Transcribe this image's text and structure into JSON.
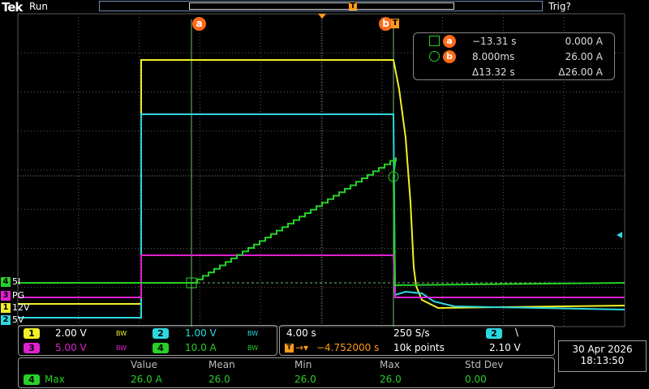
{
  "header": {
    "brand": "Tek",
    "status": "Run",
    "trigger_state": "Trig?"
  },
  "colors": {
    "ch1": "#f0f028",
    "ch2": "#2cd8e0",
    "ch3": "#e020d0",
    "ch4": "#28d028",
    "cursor": "#ff6a1a",
    "grid": "#5a5a5a"
  },
  "cursors": {
    "a_label": "a",
    "b_label": "b",
    "readout": {
      "a_time": "−13.31 s",
      "a_value": "0.000 A",
      "b_time": "8.000ms",
      "b_value": "26.00 A",
      "delta_time": "Δ13.32 s",
      "delta_value": "Δ26.00 A"
    }
  },
  "channel_labels": [
    {
      "num": "4",
      "text": "5I",
      "color": "#28d028"
    },
    {
      "num": "3",
      "text": "PG",
      "color": "#e020d0"
    },
    {
      "num": "1",
      "text": "12V",
      "color": "#f0f028"
    },
    {
      "num": "2",
      "text": "5V",
      "color": "#2cd8e0"
    }
  ],
  "channels": {
    "ch1": {
      "num": "1",
      "scale": "2.00 V",
      "bw": "BW"
    },
    "ch2": {
      "num": "2",
      "scale": "1.00 V",
      "bw": "BW"
    },
    "ch3": {
      "num": "3",
      "scale": "5.00 V",
      "bw": "BW"
    },
    "ch4": {
      "num": "4",
      "scale": "10.0 A",
      "bw": "BW"
    }
  },
  "timebase": {
    "scale": "4.00 s",
    "sample_rate": "250 S/s",
    "trig_pos": "−4.752000 s",
    "record_length": "10k points",
    "trig_source": "2",
    "trig_slope": "\\",
    "trig_level": "2.10 V"
  },
  "measurements": {
    "headers": [
      "Value",
      "Mean",
      "Min",
      "Max",
      "Std Dev"
    ],
    "rows": [
      {
        "channel": "4",
        "name": "Max",
        "values": [
          "26.0 A",
          "26.0",
          "26.0",
          "26.0",
          "0.00"
        ]
      }
    ]
  },
  "datetime": {
    "date": "30 Apr 2026",
    "time": "18:13:50"
  },
  "icons": {
    "trigger_marker": "trigger-position-icon",
    "trigger_level": "trigger-level-arrow-icon"
  }
}
